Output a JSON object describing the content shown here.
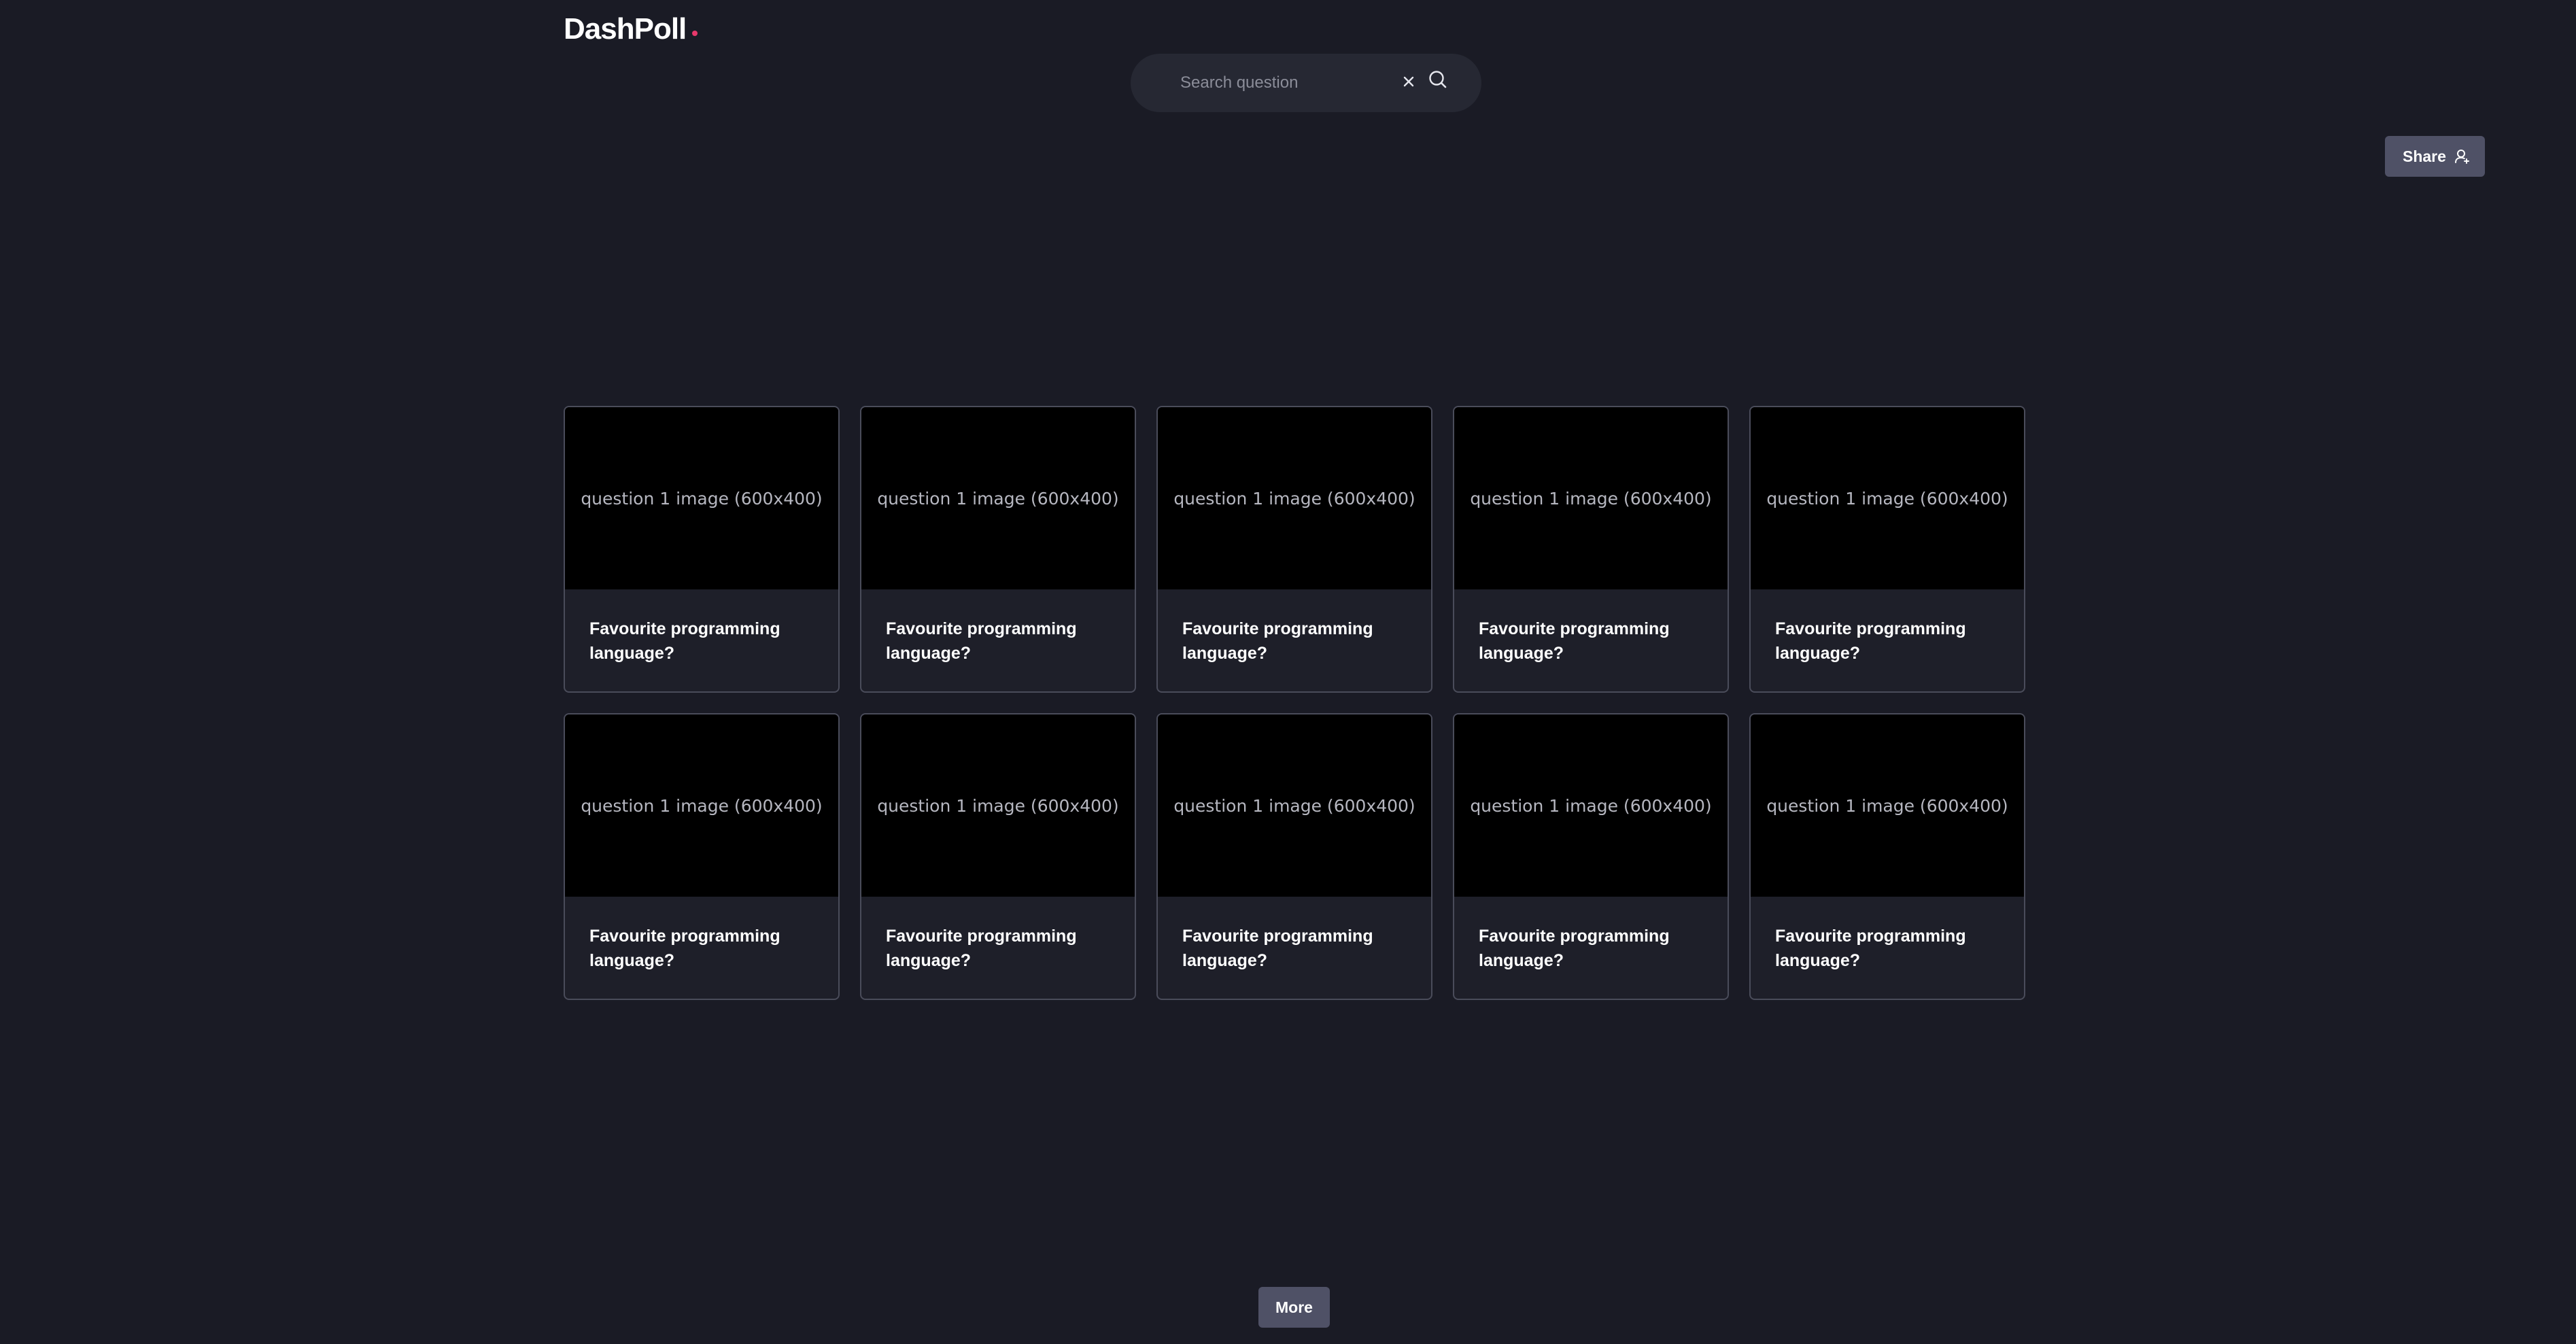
{
  "header": {
    "logo_text": "DashPoll",
    "logo_dot_color": "#e8386b"
  },
  "search": {
    "placeholder": "Search question",
    "value": "",
    "clear_icon": "close-icon",
    "search_icon": "search-icon"
  },
  "share": {
    "label": "Share",
    "icon": "user-share-icon"
  },
  "cards": [
    {
      "image_label": "question 1 image (600x400)",
      "title": "Favourite programming language?"
    },
    {
      "image_label": "question 1 image (600x400)",
      "title": "Favourite programming language?"
    },
    {
      "image_label": "question 1 image (600x400)",
      "title": "Favourite programming language?"
    },
    {
      "image_label": "question 1 image (600x400)",
      "title": "Favourite programming language?"
    },
    {
      "image_label": "question 1 image (600x400)",
      "title": "Favourite programming language?"
    },
    {
      "image_label": "question 1 image (600x400)",
      "title": "Favourite programming language?"
    },
    {
      "image_label": "question 1 image (600x400)",
      "title": "Favourite programming language?"
    },
    {
      "image_label": "question 1 image (600x400)",
      "title": "Favourite programming language?"
    },
    {
      "image_label": "question 1 image (600x400)",
      "title": "Favourite programming language?"
    },
    {
      "image_label": "question 1 image (600x400)",
      "title": "Favourite programming language?"
    }
  ],
  "more": {
    "label": "More"
  },
  "colors": {
    "background": "#1a1b25",
    "button": "#4f5166",
    "card_border": "#4a4c5a",
    "accent_dot": "#e8386b"
  }
}
